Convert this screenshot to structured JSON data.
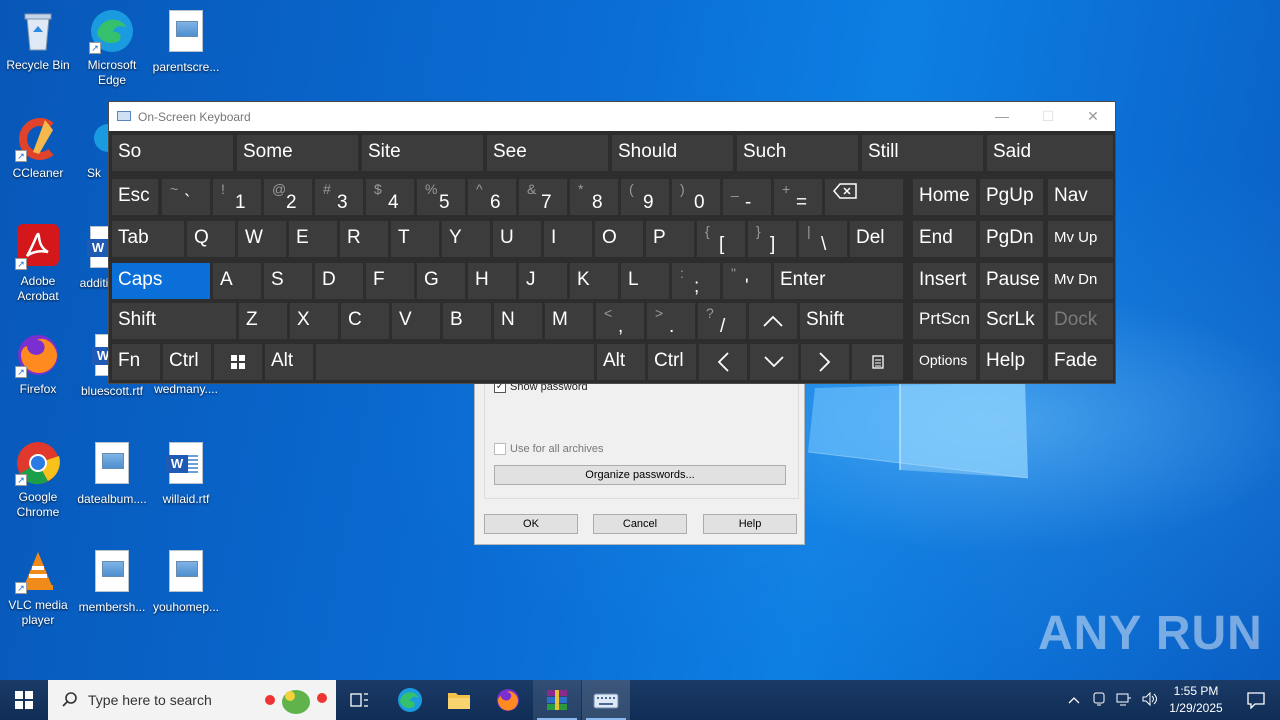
{
  "desktop": {
    "icons": [
      {
        "label": "Recycle Bin"
      },
      {
        "label": "Microsoft Edge"
      },
      {
        "label": "parentscre..."
      },
      {
        "label": "CCleaner"
      },
      {
        "label": "Sk"
      },
      {
        "label": "Adobe Acrobat"
      },
      {
        "label": "additi"
      },
      {
        "label": "Firefox"
      },
      {
        "label": "bluescott.rtf"
      },
      {
        "label": "wedmany...."
      },
      {
        "label": "Google Chrome"
      },
      {
        "label": "datealbum...."
      },
      {
        "label": "willaid.rtf"
      },
      {
        "label": "VLC media player"
      },
      {
        "label": "membersh..."
      },
      {
        "label": "youhomep..."
      }
    ]
  },
  "dialog": {
    "show_password": "Show password",
    "use_all_archives": "Use for all archives",
    "organize": "Organize passwords...",
    "ok": "OK",
    "cancel": "Cancel",
    "help": "Help"
  },
  "osk": {
    "title": "On-Screen Keyboard",
    "controls": {
      "minimize": "—",
      "maximize": "☐",
      "close": "✕"
    },
    "suggestions": [
      "So",
      "Some",
      "Site",
      "See",
      "Should",
      "Such",
      "Still",
      "Said"
    ],
    "row1": {
      "esc": "Esc",
      "keys": [
        {
          "top": "~",
          "bot": "`"
        },
        {
          "top": "!",
          "bot": "1"
        },
        {
          "top": "@",
          "bot": "2"
        },
        {
          "top": "#",
          "bot": "3"
        },
        {
          "top": "$",
          "bot": "4"
        },
        {
          "top": "%",
          "bot": "5"
        },
        {
          "top": "^",
          "bot": "6"
        },
        {
          "top": "&",
          "bot": "7"
        },
        {
          "top": "*",
          "bot": "8"
        },
        {
          "top": "(",
          "bot": "9"
        },
        {
          "top": ")",
          "bot": "0"
        },
        {
          "top": "_",
          "bot": "-"
        },
        {
          "top": "+",
          "bot": "="
        }
      ],
      "home": "Home",
      "pgup": "PgUp",
      "nav": "Nav"
    },
    "row2": {
      "tab": "Tab",
      "letters": [
        "Q",
        "W",
        "E",
        "R",
        "T",
        "Y",
        "U",
        "I",
        "O",
        "P"
      ],
      "bracket_open": {
        "top": "{",
        "bot": "["
      },
      "bracket_close": {
        "top": "}",
        "bot": "]"
      },
      "pipe": {
        "top": "|",
        "bot": "\\"
      },
      "del": "Del",
      "end": "End",
      "pgdn": "PgDn",
      "mvup": "Mv Up"
    },
    "row3": {
      "caps": "Caps",
      "letters": [
        "A",
        "S",
        "D",
        "F",
        "G",
        "H",
        "J",
        "K",
        "L"
      ],
      "semicolon": {
        "top": ":",
        "bot": ";"
      },
      "quote": {
        "top": "\"",
        "bot": "'"
      },
      "enter": "Enter",
      "insert": "Insert",
      "pause": "Pause",
      "mvdn": "Mv Dn"
    },
    "row4": {
      "shift_left": "Shift",
      "letters": [
        "Z",
        "X",
        "C",
        "V",
        "B",
        "N",
        "M"
      ],
      "comma": {
        "top": "<",
        "bot": ","
      },
      "period": {
        "top": ">",
        "bot": "."
      },
      "slash": {
        "top": "?",
        "bot": "/"
      },
      "shift_right": "Shift",
      "prtscn": "PrtScn",
      "scrlk": "ScrLk",
      "dock": "Dock"
    },
    "row5": {
      "fn": "Fn",
      "ctrl_left": "Ctrl",
      "alt_left": "Alt",
      "alt_right": "Alt",
      "ctrl_right": "Ctrl",
      "options": "Options",
      "help": "Help",
      "fade": "Fade"
    }
  },
  "taskbar": {
    "search_placeholder": "Type here to search",
    "time": "1:55 PM",
    "date": "1/29/2025"
  },
  "watermark": "ANY RUN"
}
